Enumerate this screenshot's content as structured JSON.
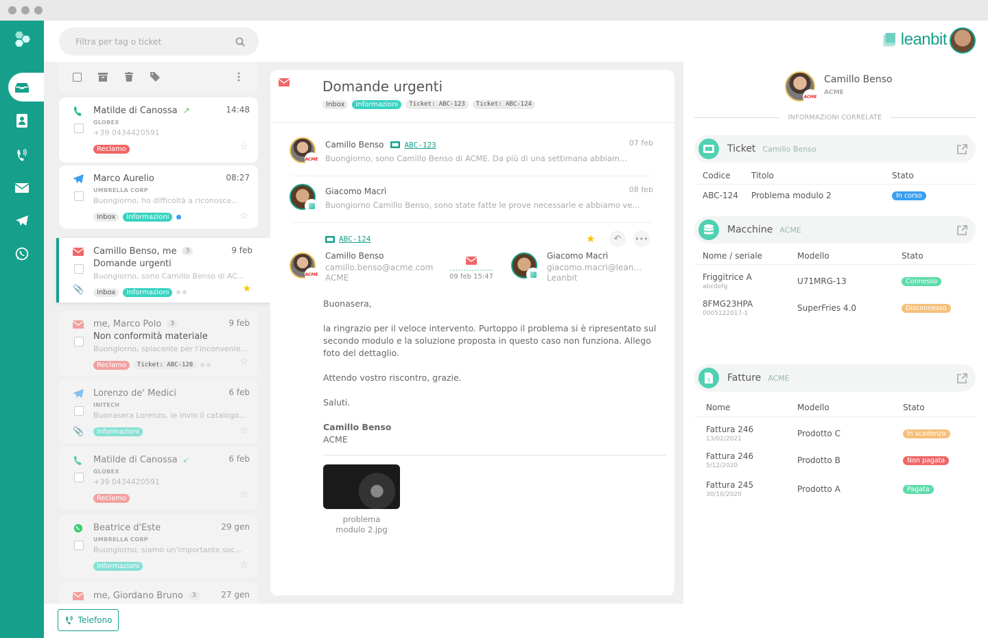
{
  "search": {
    "placeholder": "Filtra per tag o ticket"
  },
  "brand": {
    "name": "leanbit"
  },
  "sidebar": {
    "items": [
      {
        "name": "inbox",
        "active": true
      },
      {
        "name": "contacts"
      },
      {
        "name": "phone"
      },
      {
        "name": "email"
      },
      {
        "name": "telegram"
      },
      {
        "name": "whatsapp"
      }
    ]
  },
  "list": {
    "items": [
      {
        "channel": "phone",
        "name": "Matilde di Canossa",
        "direction": "outgoing",
        "time": "14:48",
        "company": "GLOBEX",
        "preview": "+39 0434420591",
        "tags": [
          "Reclamo"
        ]
      },
      {
        "channel": "telegram",
        "name": "Marco Aurelio",
        "time": "08:27",
        "company": "UMBRELLA CORP",
        "preview": "Buongiorno, ho difficoltà a riconosce...",
        "tags": [
          "Inbox",
          "Informazioni"
        ]
      },
      {
        "channel": "email",
        "name": "Camillo Benso, me",
        "count": "3",
        "time": "9 feb",
        "subject": "Domande urgenti",
        "preview": "Buongiorno, sono Camillo Benso di AC...",
        "tags": [
          "Inbox",
          "Informazioni"
        ],
        "starred": true,
        "selected": true
      },
      {
        "channel": "email",
        "name": "me, Marco Polo",
        "count": "3",
        "time": "9 feb",
        "subject": "Non conformità materiale",
        "preview": "Buongiorno, spiacente per l'inconvenie...",
        "tags": [
          "Reclamo",
          "Ticket: ABC-120"
        ]
      },
      {
        "channel": "telegram",
        "name": "Lorenzo de' Medici",
        "time": "6 feb",
        "company": "INITECH",
        "preview": "Buonasera Lorenzo, le invio il catalogo...",
        "tags": [
          "Informazioni"
        ]
      },
      {
        "channel": "phone",
        "name": "Matilde di Canossa",
        "direction": "incoming",
        "time": "6 feb",
        "company": "GLOBEX",
        "preview": "+39 0434420591",
        "tags": [
          "Reclamo"
        ]
      },
      {
        "channel": "whatsapp",
        "name": "Beatrice d'Este",
        "time": "29 gen",
        "company": "UMBRELLA CORP",
        "preview": "Buongiorno, siamo un'importante soc...",
        "tags": [
          "Informazioni"
        ]
      },
      {
        "channel": "email",
        "name": "me, Giordano Bruno",
        "count": "3",
        "time": "27 gen"
      }
    ]
  },
  "phone_button": {
    "label": "Telefono"
  },
  "thread": {
    "title": "Domande urgenti",
    "tags": [
      "Inbox",
      "Informazioni",
      "Ticket: ABC-123",
      "Ticket: ABC-124"
    ],
    "messages": [
      {
        "sender": "Camillo Benso",
        "ticket": "ABC-123",
        "date": "07 feb",
        "preview": "Buongiorno, sono Camillo Benso di ACME. Da più di una settimana abbiam..."
      },
      {
        "sender": "Giacomo Macrì",
        "date": "08 feb",
        "preview": "Buongiorno Camillo Benso, sono state fatte le prove necessarie e abbiamo ve..."
      }
    ],
    "expanded": {
      "ticket": "ABC-124",
      "from": {
        "name": "Camillo Benso",
        "email": "camillo.benso@acme.com",
        "company": "ACME"
      },
      "to": {
        "name": "Giacomo Macrì",
        "email": "giacomo.macri@lean...",
        "company": "Leanbit"
      },
      "datetime": "09 feb 15:47",
      "body": {
        "greeting": "Buonasera,",
        "p1": "la ringrazio per il veloce intervento. Purtoppo il problema si è ripresentato sul secondo modulo e la soluzione proposta in questo caso non funziona. Allego foto del dettaglio.",
        "p2": "Attendo vostro riscontro, grazie.",
        "p3": "Saluti.",
        "sig_name": "Camillo Benso",
        "sig_company": "ACME"
      },
      "attachment": {
        "name_line1": "problema",
        "name_line2": "modulo 2.jpg"
      }
    }
  },
  "contact": {
    "name": "Camillo Benso",
    "company": "ACME",
    "badge": "ACME"
  },
  "related": {
    "label": "INFORMAZIONI CORRELATE",
    "ticket": {
      "title": "Ticket",
      "subtitle": "Camillo Benso",
      "headers": [
        "Codice",
        "Titolo",
        "Stato"
      ],
      "rows": [
        {
          "code": "ABC-124",
          "title": "Problema modulo 2",
          "status": "In corso",
          "color": "#3a9ff0"
        }
      ]
    },
    "machines": {
      "title": "Macchine",
      "subtitle": "ACME",
      "headers": [
        "Nome / seriale",
        "Modello",
        "Stato"
      ],
      "rows": [
        {
          "name": "Friggitrice A",
          "serial": "abcdefg",
          "model": "U71MRG-13",
          "status": "Connesso",
          "color": "#5ddcaa"
        },
        {
          "name": "8FMG23HPA",
          "serial": "0005122017-1",
          "model": "SuperFries 4.0",
          "status": "Disconnesso",
          "color": "#f5c07a"
        }
      ]
    },
    "invoices": {
      "title": "Fatture",
      "subtitle": "ACME",
      "headers": [
        "Nome",
        "Modello",
        "Stato"
      ],
      "rows": [
        {
          "name": "Fattura 246",
          "date": "13/02/2021",
          "model": "Prodotto C",
          "status": "In scadenza",
          "color": "#f5c07a"
        },
        {
          "name": "Fattura 246",
          "date": "5/12/2020",
          "model": "Prodotto B",
          "status": "Non pagata",
          "color": "#f06767"
        },
        {
          "name": "Fattura 245",
          "date": "30/10/2020",
          "model": "Prodotto A",
          "status": "Pagata",
          "color": "#5ddcaa"
        }
      ]
    }
  }
}
